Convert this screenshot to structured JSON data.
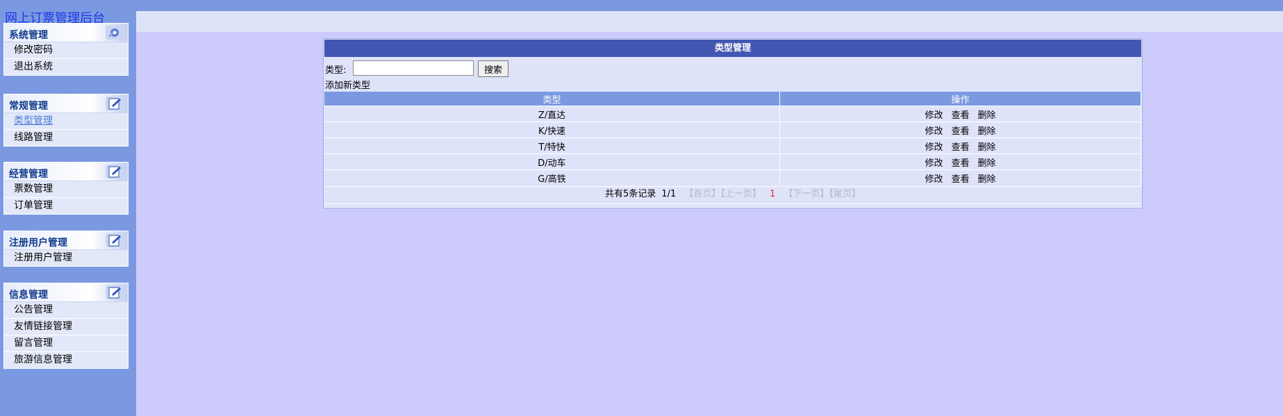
{
  "app_title": "网上订票管理后台",
  "sidebar": {
    "panels": [
      {
        "title": "系统管理",
        "icon": "settings-gear-icon",
        "items": [
          "修改密码",
          "退出系统"
        ]
      },
      {
        "title": "常规管理",
        "icon": "edit-note-icon",
        "items": [
          "类型管理",
          "线路管理"
        ],
        "active": "类型管理"
      },
      {
        "title": "经营管理",
        "icon": "edit-note-icon",
        "items": [
          "票数管理",
          "订单管理"
        ]
      },
      {
        "title": "注册用户管理",
        "icon": "edit-note-icon",
        "items": [
          "注册用户管理"
        ]
      },
      {
        "title": "信息管理",
        "icon": "edit-note-icon",
        "items": [
          "公告管理",
          "友情链接管理",
          "留言管理",
          "旅游信息管理"
        ]
      }
    ]
  },
  "content": {
    "title": "类型管理",
    "search": {
      "label": "类型:",
      "value": "",
      "button": "搜索"
    },
    "add_link": "添加新类型",
    "table": {
      "headers": [
        "类型",
        "操作"
      ],
      "rows": [
        "Z/直达",
        "K/快速",
        "T/特快",
        "D/动车",
        "G/高铁"
      ],
      "actions": [
        "修改",
        "查看",
        "删除"
      ]
    },
    "pagination": {
      "summary": "共有5条记录",
      "page_info": "1/1",
      "first": "【首页】",
      "prev": "【上一页】",
      "current": "1",
      "next": "【下一页】",
      "last": "【尾页】"
    }
  },
  "colors": {
    "sidebar_bg": "#7b99e1",
    "main_bg": "#cccbfb",
    "header_bar": "#4356b1",
    "table_header": "#7b99e1"
  }
}
